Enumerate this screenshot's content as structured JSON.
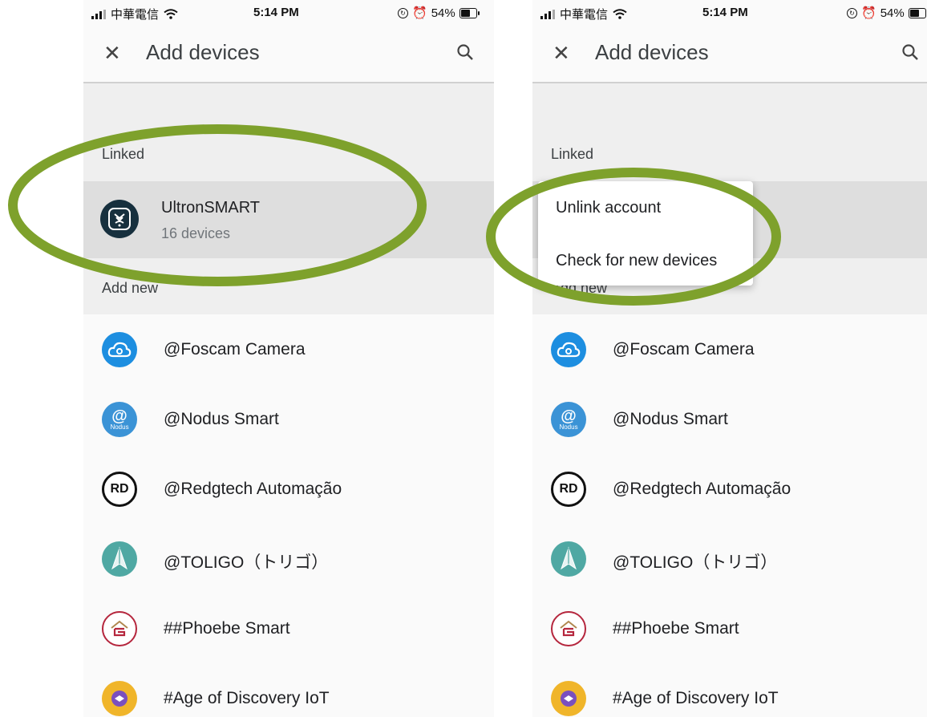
{
  "status_bar": {
    "carrier": "中華電信",
    "time": "5:14 PM",
    "battery": "54%"
  },
  "app_bar": {
    "title": "Add devices",
    "close_icon": "close-icon",
    "search_icon": "search-icon"
  },
  "sections": {
    "linked": "Linked",
    "add_new": "Add new"
  },
  "linked_account": {
    "name": "UltronSMART",
    "subtitle": "16 devices"
  },
  "context_menu": {
    "unlink": "Unlink account",
    "check": "Check for new devices"
  },
  "providers": [
    {
      "label": "@Foscam Camera",
      "icon": "cloud-eye-icon"
    },
    {
      "label": "@Nodus Smart",
      "icon": "at-sign-icon",
      "icon_text": "Nodus"
    },
    {
      "label": "@Redgtech Automação",
      "icon": "rd-logo-icon",
      "icon_text": "RD"
    },
    {
      "label": "@TOLIGO（トリゴ）",
      "icon": "paper-plane-icon"
    },
    {
      "label": "##Phoebe Smart",
      "icon": "house-logo-icon"
    },
    {
      "label": "#Age of Discovery IoT",
      "icon": "compass-icon"
    }
  ],
  "colors": {
    "highlight_ellipse": "#7ea12c",
    "foscam": "#1d8ee0",
    "nodus": "#3b93d6",
    "toligo": "#4fa8a3",
    "phoebe": "#b5263d",
    "age": "#f0b52a"
  }
}
